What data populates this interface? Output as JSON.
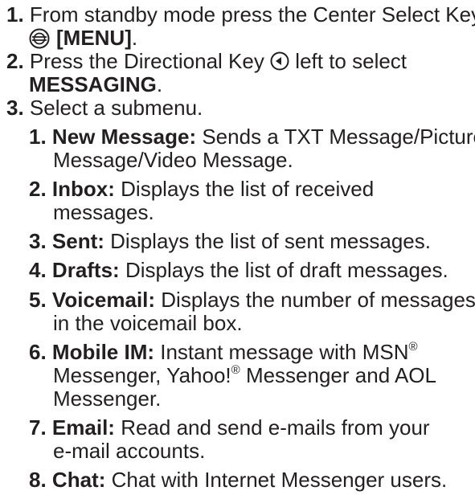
{
  "steps": [
    {
      "number": "1.",
      "line1": "From standby mode press the Center Select Key",
      "key_label": "[MENU]",
      "key_suffix": ".",
      "icon": "center-select-key-icon"
    },
    {
      "number": "2.",
      "line1_prefix": "Press the Directional Key",
      "line1_suffix": "left to select",
      "target": "MESSAGING",
      "target_suffix": ".",
      "icon": "directional-key-left-icon"
    },
    {
      "number": "3.",
      "text": "Select a submenu."
    }
  ],
  "submenu": [
    {
      "number": "1.",
      "title": "New Message:",
      "line1": "Sends a TXT Message/Picture",
      "line2": "Message/Video Message."
    },
    {
      "number": "2.",
      "title": "Inbox:",
      "line1": "Displays the list of received",
      "line2": "messages."
    },
    {
      "number": "3.",
      "title": "Sent:",
      "line1": "Displays the list of sent messages."
    },
    {
      "number": "4.",
      "title": "Drafts:",
      "line1": "Displays the list of draft messages."
    },
    {
      "number": "5.",
      "title": "Voicemail:",
      "line1": "Displays the number of messages",
      "line2": "in the voicemail box."
    },
    {
      "number": "6.",
      "title": "Mobile IM:",
      "line1": "Instant message with MSN",
      "reg1": "®",
      "line2a": "Messenger, Yahoo!",
      "reg2": "®",
      "line2b": "Messenger and AOL",
      "line3": "Messenger."
    },
    {
      "number": "7.",
      "title": "Email:",
      "line1": "Read and send e-mails from your",
      "line2": "e-mail accounts."
    },
    {
      "number": "8.",
      "title": "Chat:",
      "line1": "Chat with Internet Messenger users."
    }
  ]
}
